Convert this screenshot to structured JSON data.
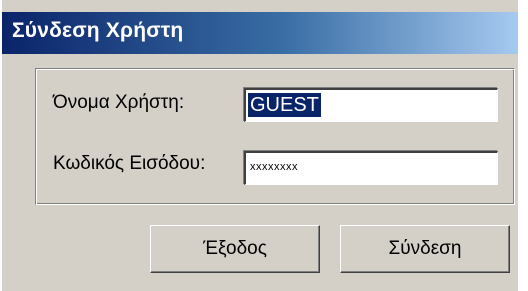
{
  "window": {
    "title": "Σύνδεση Χρήστη"
  },
  "form": {
    "username_label": "Όνομα Χρήστη:",
    "username_value": "GUEST",
    "password_label": "Κωδικός Εισόδου:",
    "password_value": "xxxxxxxx"
  },
  "buttons": {
    "exit_label": "Έξοδος",
    "login_label": "Σύνδεση"
  },
  "colors": {
    "title_bar_start": "#0a246a",
    "title_bar_end": "#a6caf0",
    "dialog_face": "#d4d0c8",
    "selection": "#0a246a"
  }
}
